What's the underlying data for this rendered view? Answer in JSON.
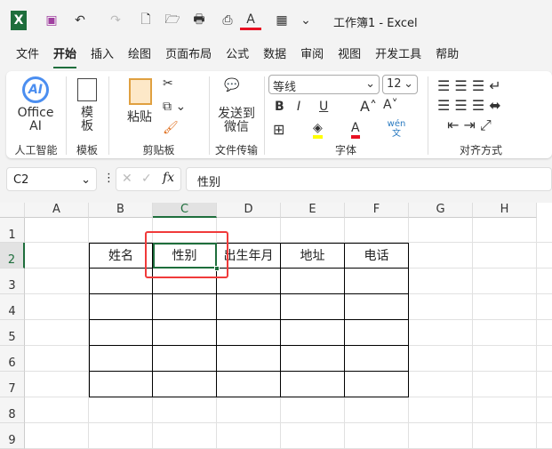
{
  "window": {
    "title": "工作簿1  -  Excel"
  },
  "quick_access": [
    {
      "name": "excel-logo-icon",
      "glyph": "X"
    },
    {
      "name": "save-icon",
      "glyph": "▣"
    },
    {
      "name": "undo-icon",
      "glyph": "↶"
    },
    {
      "name": "redo-icon",
      "glyph": "↷"
    },
    {
      "name": "new-file-icon",
      "glyph": "🗋"
    },
    {
      "name": "open-folder-icon",
      "glyph": "🗁"
    },
    {
      "name": "print-preview-icon",
      "glyph": "🖶"
    },
    {
      "name": "print-check-icon",
      "glyph": "⎙"
    },
    {
      "name": "font-color-icon",
      "glyph": "A"
    },
    {
      "name": "freeze-panes-icon",
      "glyph": "▦"
    },
    {
      "name": "customize-icon",
      "glyph": "⌄"
    }
  ],
  "tabs": [
    "文件",
    "开始",
    "插入",
    "绘图",
    "页面布局",
    "公式",
    "数据",
    "审阅",
    "视图",
    "开发工具",
    "帮助"
  ],
  "active_tab": "开始",
  "ribbon": {
    "groups": [
      "人工智能",
      "模板",
      "剪贴板",
      "文件传输",
      "字体",
      "对齐方式"
    ],
    "office_ai": "Office AI",
    "ai_badge": "AI",
    "template": "模板",
    "paste": "粘贴",
    "send_wechat": "发送到微信",
    "font_name": "等线",
    "font_size": "12",
    "bold": "B",
    "italic": "I",
    "underline": "U",
    "grow": "A˄",
    "shrink": "A˅",
    "wen": "wén文",
    "font_color_hex": "#e81123",
    "highlight_hex": "#ffff00"
  },
  "formula_bar": {
    "name_box": "C2",
    "fx": "fx",
    "content": "性别"
  },
  "grid": {
    "columns": [
      "A",
      "B",
      "C",
      "D",
      "E",
      "F",
      "G",
      "H"
    ],
    "rows": [
      "1",
      "2",
      "3",
      "4",
      "5",
      "6",
      "7",
      "8",
      "9"
    ],
    "selected_cell": "C2",
    "headers": [
      "姓名",
      "性别",
      "出生年月",
      "地址",
      "电话"
    ],
    "accent": "#1e6e3c",
    "highlight_box": "#f03a3a"
  }
}
